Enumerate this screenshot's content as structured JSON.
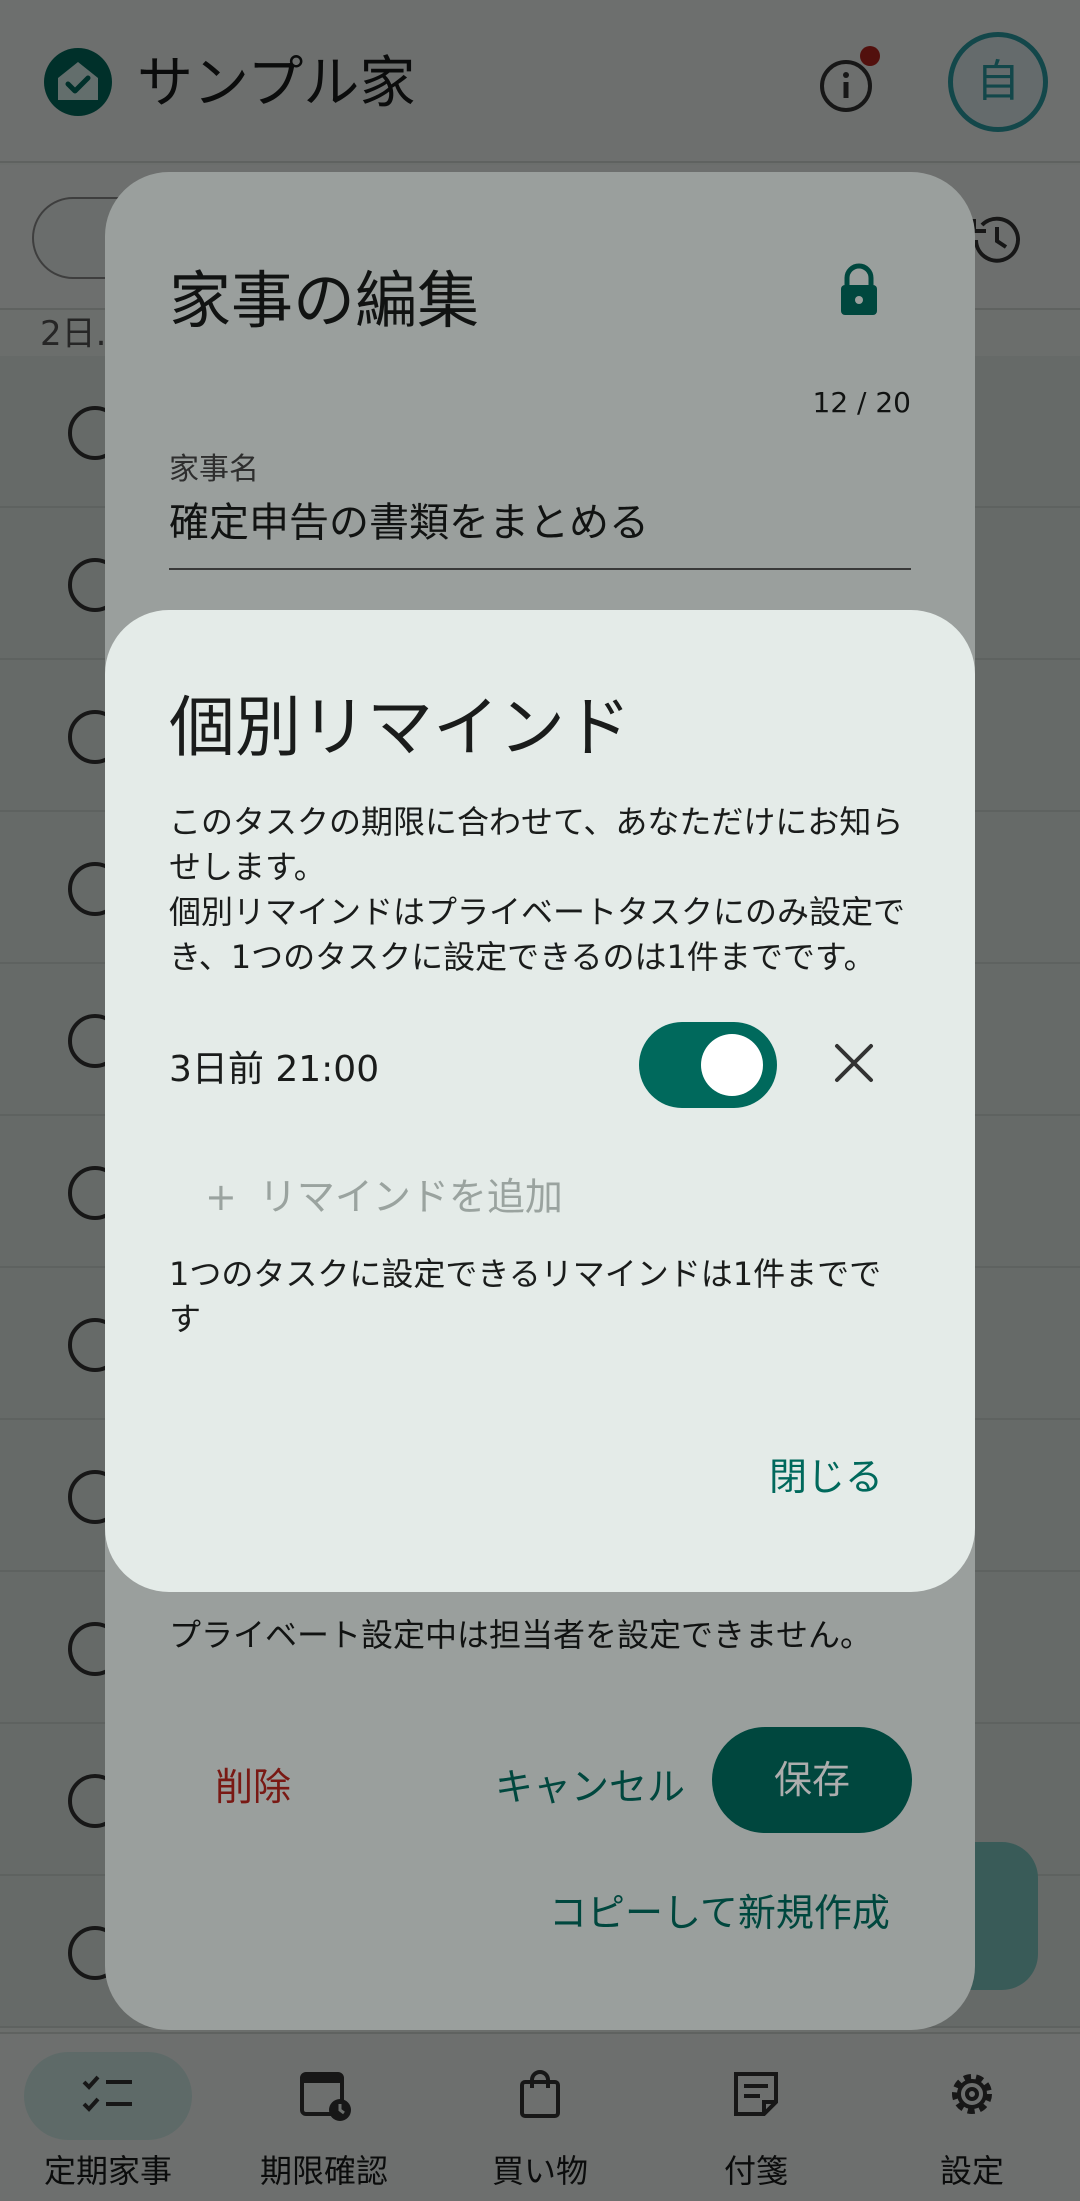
{
  "app": {
    "title": "サンプル家",
    "avatar_initial": "自"
  },
  "list": {
    "section_header": "2日..."
  },
  "nav": {
    "items": [
      {
        "label": "定期家事",
        "icon": "checklist-icon",
        "active": true
      },
      {
        "label": "期限確認",
        "icon": "calendar-clock-icon",
        "active": false
      },
      {
        "label": "買い物",
        "icon": "shopping-bag-icon",
        "active": false
      },
      {
        "label": "付箋",
        "icon": "sticky-note-icon",
        "active": false
      },
      {
        "label": "設定",
        "icon": "gear-icon",
        "active": false
      }
    ]
  },
  "edit_dialog": {
    "title": "家事の編集",
    "char_count": "12 / 20",
    "name_label": "家事名",
    "name_value": "確定申告の書類をまとめる",
    "private_note": "プライベート設定中は担当者を設定できません。",
    "delete_label": "削除",
    "cancel_label": "キャンセル",
    "save_label": "保存",
    "copy_label": "コピーして新規作成"
  },
  "remind_dialog": {
    "title": "個別リマインド",
    "description_1": "このタスクの期限に合わせて、あなただけにお知らせします。",
    "description_2": "個別リマインドはプライベートタスクにのみ設定でき、1つのタスクに設定できるのは1件までです。",
    "reminder_time": "3日前 21:00",
    "reminder_enabled": true,
    "add_label": "リマインドを追加",
    "add_icon": "+",
    "limit_note": "1つのタスクに設定できるリマインドは1件までです",
    "close_label": "閉じる"
  },
  "colors": {
    "primary": "#00695c",
    "danger": "#b3261e",
    "surface": "#e4ebe8"
  }
}
